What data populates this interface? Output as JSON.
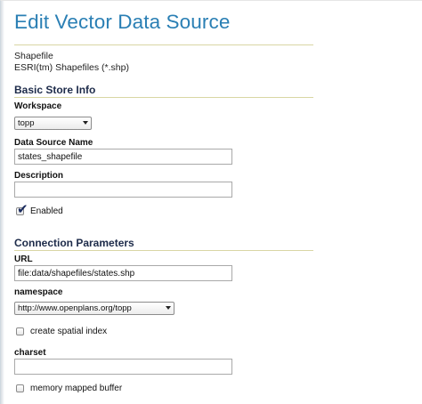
{
  "page": {
    "title": "Edit Vector Data Source",
    "store_type": "Shapefile",
    "store_description": "ESRI(tm) Shapefiles (*.shp)"
  },
  "basic_info": {
    "heading": "Basic Store Info",
    "workspace_label": "Workspace",
    "workspace_value": "topp",
    "name_label": "Data Source Name",
    "name_value": "states_shapefile",
    "description_label": "Description",
    "description_value": "",
    "enabled_label": "Enabled",
    "enabled_checked": true
  },
  "connection": {
    "heading": "Connection Parameters",
    "url_label": "URL",
    "url_value": "file:data/shapefiles/states.shp",
    "namespace_label": "namespace",
    "namespace_value": "http://www.openplans.org/topp",
    "spatial_index_label": "create spatial index",
    "spatial_index_checked": false,
    "charset_label": "charset",
    "charset_value": "",
    "memory_mapped_label": "memory mapped buffer",
    "memory_mapped_checked": false
  },
  "colors": {
    "title": "#2a7fb4",
    "section_heading": "#1d2b4a",
    "rule": "#d9d6a4"
  }
}
